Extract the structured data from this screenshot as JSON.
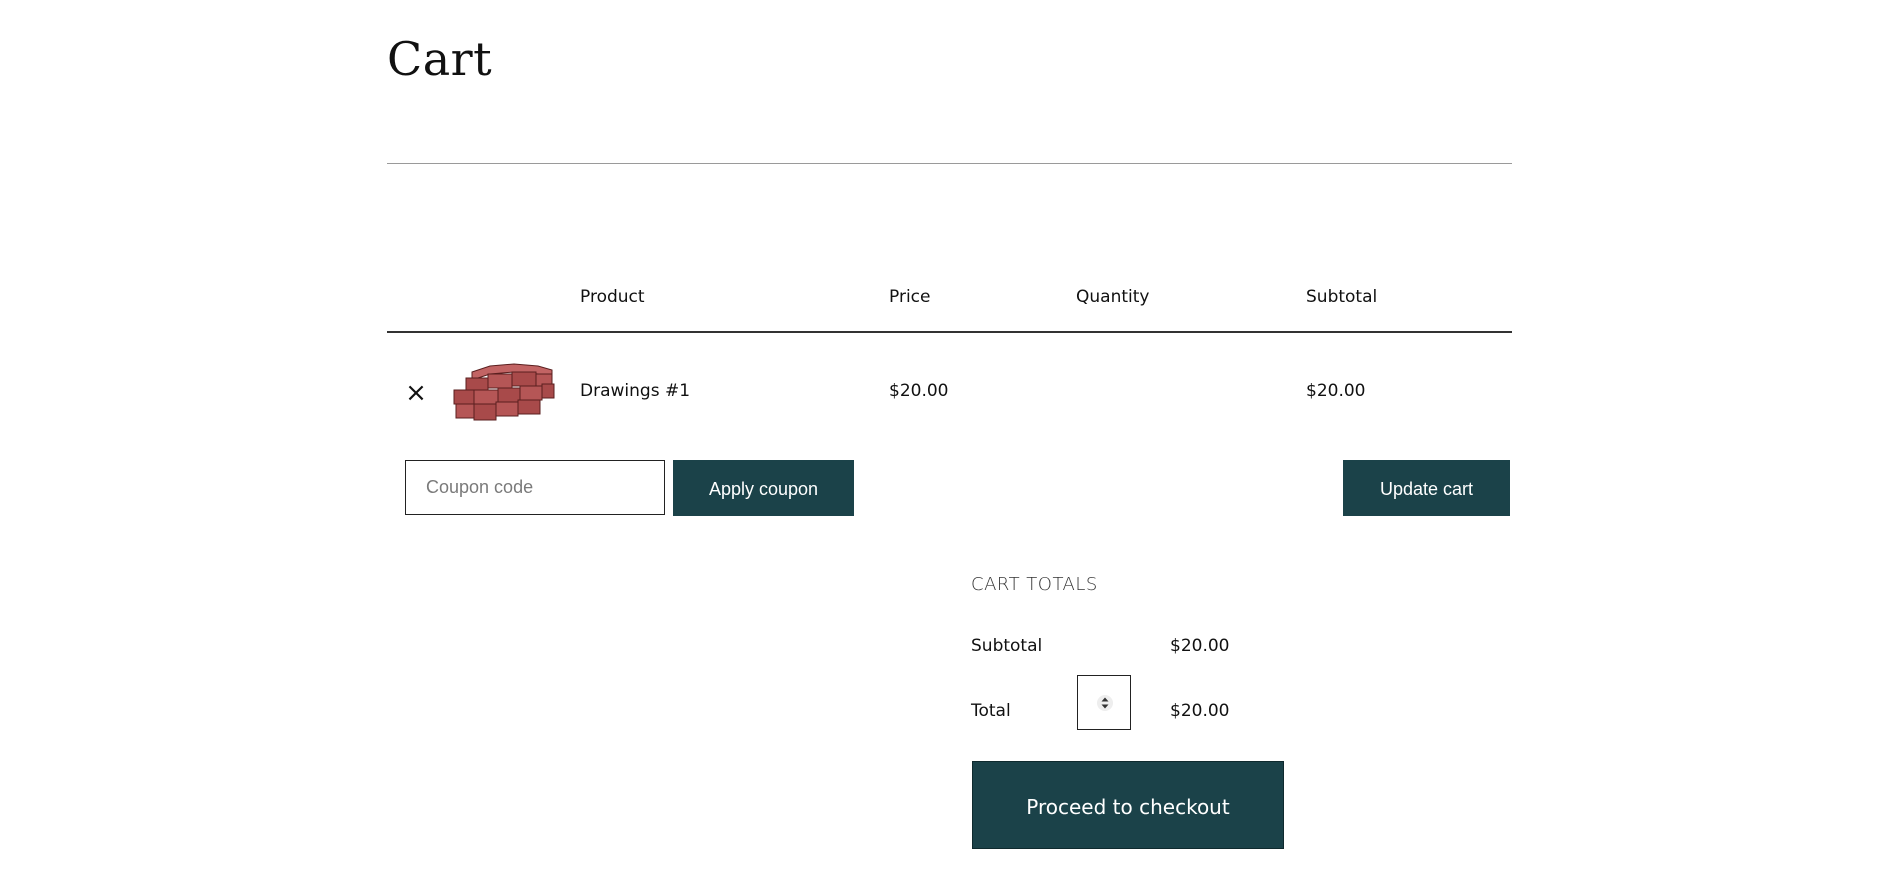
{
  "page": {
    "title": "Cart"
  },
  "table": {
    "headers": {
      "product": "Product",
      "price": "Price",
      "quantity": "Quantity",
      "subtotal": "Subtotal"
    },
    "rows": [
      {
        "remove_icon": "close-icon",
        "remove_glyph": "×",
        "thumbnail_icon": "stacked-red-boxes-image",
        "name": "Drawings #1",
        "price": "$20.00",
        "subtotal": "$20.00"
      }
    ]
  },
  "coupon": {
    "placeholder": "Coupon code",
    "value": "",
    "apply_label": "Apply coupon"
  },
  "actions": {
    "update_label": "Update cart"
  },
  "totals": {
    "heading": "CART TOTALS",
    "subtotal_label": "Subtotal",
    "subtotal_value": "$20.00",
    "total_label": "Total",
    "total_value": "$20.00",
    "stepper_icon": "sort-arrows-icon",
    "checkout_label": "Proceed to checkout"
  },
  "colors": {
    "button_bg": "#1b4249",
    "button_text": "#ffffff",
    "thumbnail_red": "#a84a4a"
  }
}
